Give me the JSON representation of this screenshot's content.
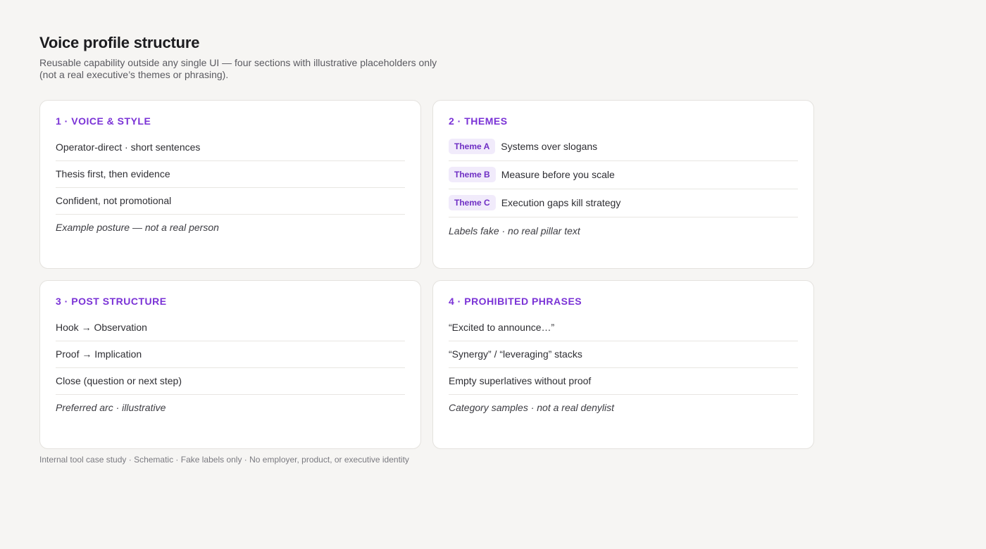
{
  "header": {
    "title": "Voice profile structure",
    "subtitle": "Reusable capability outside any single UI — four sections with illustrative placeholders only (not a real executive’s themes or phrasing)."
  },
  "sections": {
    "voice": {
      "heading": "1 · VOICE & STYLE",
      "items": [
        "Operator-direct · short sentences",
        "Thesis first, then evidence",
        "Confident, not promotional"
      ],
      "note": "Example posture — not a real person"
    },
    "themes": {
      "heading": "2 · THEMES",
      "items": [
        {
          "badge": "Theme A",
          "text": "Systems over slogans"
        },
        {
          "badge": "Theme B",
          "text": "Measure before you scale"
        },
        {
          "badge": "Theme C",
          "text": "Execution gaps kill strategy"
        }
      ],
      "note": "Labels fake · no real pillar text"
    },
    "structure": {
      "heading": "3 · POST STRUCTURE",
      "items": [
        "Hook → Observation",
        "Proof → Implication",
        "Close (question or next step)"
      ],
      "note": "Preferred arc · illustrative"
    },
    "prohibited": {
      "heading": "4 · PROHIBITED PHRASES",
      "items": [
        "“Excited to announce…”",
        "“Synergy” / “leveraging” stacks",
        "Empty superlatives without proof"
      ],
      "note": "Category samples · not a real denylist"
    }
  },
  "footer": "Internal tool case study · Schematic · Fake labels only · No employer, product, or executive identity",
  "colors": {
    "accent": "#7a32d6",
    "badge_bg": "#f1ebfb",
    "background": "#f6f5f3",
    "card": "#ffffff"
  }
}
